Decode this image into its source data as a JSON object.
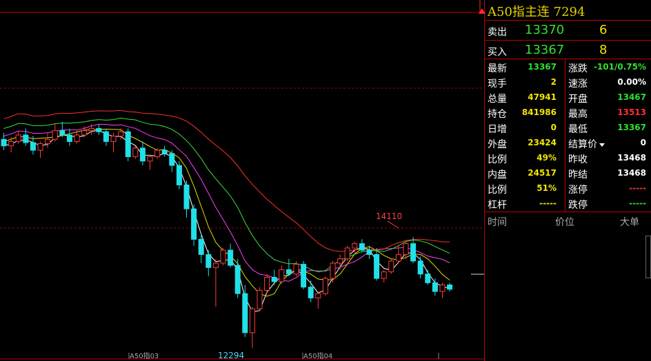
{
  "header": {
    "title": "A50指主连",
    "code": "7294"
  },
  "orderbook": {
    "sell": {
      "label": "卖出",
      "price": "13370",
      "volume": "6"
    },
    "buy": {
      "label": "买入",
      "price": "13367",
      "volume": "8"
    }
  },
  "quotes": {
    "left": [
      {
        "label": "最新",
        "value": "13367",
        "color": "#30e030"
      },
      {
        "label": "现手",
        "value": "2",
        "color": "#f2e600"
      },
      {
        "label": "总量",
        "value": "47941",
        "color": "#f2e600"
      },
      {
        "label": "持仓",
        "value": "841986",
        "color": "#f2e600"
      },
      {
        "label": "日增",
        "value": "0",
        "color": "#f2e600"
      },
      {
        "label": "外盘",
        "value": "23424",
        "color": "#f2e600"
      },
      {
        "label": "比例",
        "value": "49%",
        "color": "#f2e600"
      },
      {
        "label": "内盘",
        "value": "24517",
        "color": "#f2e600"
      },
      {
        "label": "比例",
        "value": "51%",
        "color": "#f2e600"
      },
      {
        "label": "杠杆",
        "value": "-----",
        "color": "#f2e600"
      }
    ],
    "right": [
      {
        "label": "涨跌",
        "value": "-101/0.75%",
        "color": "#30e030"
      },
      {
        "label": "速涨",
        "value": "0.00%",
        "color": "#ffffff"
      },
      {
        "label": "开盘",
        "value": "13467",
        "color": "#30e030"
      },
      {
        "label": "最高",
        "value": "13513",
        "color": "#ff3030"
      },
      {
        "label": "最低",
        "value": "13367",
        "color": "#30e030"
      },
      {
        "label": "结算价",
        "value": "0",
        "color": "#ffffff"
      },
      {
        "label": "昨收",
        "value": "13468",
        "color": "#ffffff"
      },
      {
        "label": "昨结",
        "value": "13468",
        "color": "#ffffff"
      },
      {
        "label": "涨停",
        "value": "-----",
        "color": "#ff3030"
      },
      {
        "label": "跌停",
        "value": "-----",
        "color": "#30e030"
      }
    ]
  },
  "trades": {
    "col_time": "时间",
    "col_price": "价位",
    "col_big": "大单"
  },
  "chart": {
    "high_label": "14110",
    "low_label": "12294",
    "contract_labels": [
      "A50指03",
      "A50指04"
    ]
  },
  "chart_data": {
    "type": "candlestick",
    "title": "",
    "annotations": [
      {
        "text": "14110",
        "kind": "period-high"
      },
      {
        "text": "12294",
        "kind": "period-low"
      }
    ],
    "x_labels": [
      "A50指03",
      "A50指04"
    ],
    "ohlc": [
      [
        13620,
        13680,
        13520,
        13560
      ],
      [
        13560,
        13640,
        13500,
        13600
      ],
      [
        13600,
        13700,
        13580,
        13660
      ],
      [
        13660,
        13720,
        13560,
        13590
      ],
      [
        13590,
        13650,
        13480,
        13520
      ],
      [
        13520,
        13600,
        13450,
        13580
      ],
      [
        13580,
        13680,
        13540,
        13620
      ],
      [
        13620,
        13760,
        13600,
        13700
      ],
      [
        13700,
        13780,
        13640,
        13660
      ],
      [
        13660,
        13720,
        13560,
        13600
      ],
      [
        13600,
        13700,
        13580,
        13660
      ],
      [
        13660,
        13740,
        13640,
        13700
      ],
      [
        13700,
        13760,
        13660,
        13720
      ],
      [
        13720,
        13760,
        13660,
        13690
      ],
      [
        13690,
        13720,
        13560,
        13600
      ],
      [
        13600,
        13680,
        13500,
        13650
      ],
      [
        13650,
        13720,
        13620,
        13690
      ],
      [
        13690,
        13720,
        13420,
        13460
      ],
      [
        13460,
        13560,
        13440,
        13540
      ],
      [
        13540,
        13600,
        13380,
        13420
      ],
      [
        13420,
        13480,
        13340,
        13460
      ],
      [
        13460,
        13540,
        13440,
        13520
      ],
      [
        13520,
        13560,
        13460,
        13490
      ],
      [
        13490,
        13520,
        13320,
        13380
      ],
      [
        13380,
        13420,
        13160,
        13200
      ],
      [
        13200,
        13240,
        12900,
        12980
      ],
      [
        12980,
        13020,
        12640,
        12700
      ],
      [
        12700,
        12760,
        12480,
        12560
      ],
      [
        12560,
        12600,
        12360,
        12440
      ],
      [
        12440,
        12520,
        12080,
        12480
      ],
      [
        12480,
        12620,
        12460,
        12600
      ],
      [
        12600,
        12660,
        12440,
        12460
      ],
      [
        12460,
        12520,
        12160,
        12200
      ],
      [
        12200,
        12280,
        11800,
        11840
      ],
      [
        11840,
        12080,
        11700,
        12060
      ],
      [
        12060,
        12260,
        12040,
        12230
      ],
      [
        12230,
        12380,
        12200,
        12350
      ],
      [
        12350,
        12420,
        12280,
        12310
      ],
      [
        12310,
        12460,
        12290,
        12420
      ],
      [
        12420,
        12520,
        12360,
        12380
      ],
      [
        12380,
        12500,
        12360,
        12470
      ],
      [
        12470,
        12500,
        12240,
        12260
      ],
      [
        12260,
        12320,
        12120,
        12160
      ],
      [
        12160,
        12220,
        12060,
        12200
      ],
      [
        12200,
        12360,
        12180,
        12340
      ],
      [
        12340,
        12500,
        12300,
        12480
      ],
      [
        12480,
        12560,
        12420,
        12520
      ],
      [
        12520,
        12640,
        12500,
        12620
      ],
      [
        12620,
        12680,
        12560,
        12660
      ],
      [
        12660,
        12700,
        12580,
        12600
      ],
      [
        12600,
        12640,
        12520,
        12560
      ],
      [
        12560,
        12620,
        12320,
        12340
      ],
      [
        12340,
        12420,
        12300,
        12400
      ],
      [
        12400,
        12520,
        12380,
        12500
      ],
      [
        12500,
        12640,
        12480,
        12560
      ],
      [
        12560,
        12680,
        12520,
        12660
      ],
      [
        12660,
        12720,
        12480,
        12500
      ],
      [
        12500,
        12540,
        12340,
        12380
      ],
      [
        12380,
        12420,
        12280,
        12300
      ],
      [
        12300,
        12340,
        12180,
        12220
      ],
      [
        12220,
        12300,
        12160,
        12280
      ],
      [
        12280,
        12300,
        12220,
        12240
      ]
    ]
  }
}
